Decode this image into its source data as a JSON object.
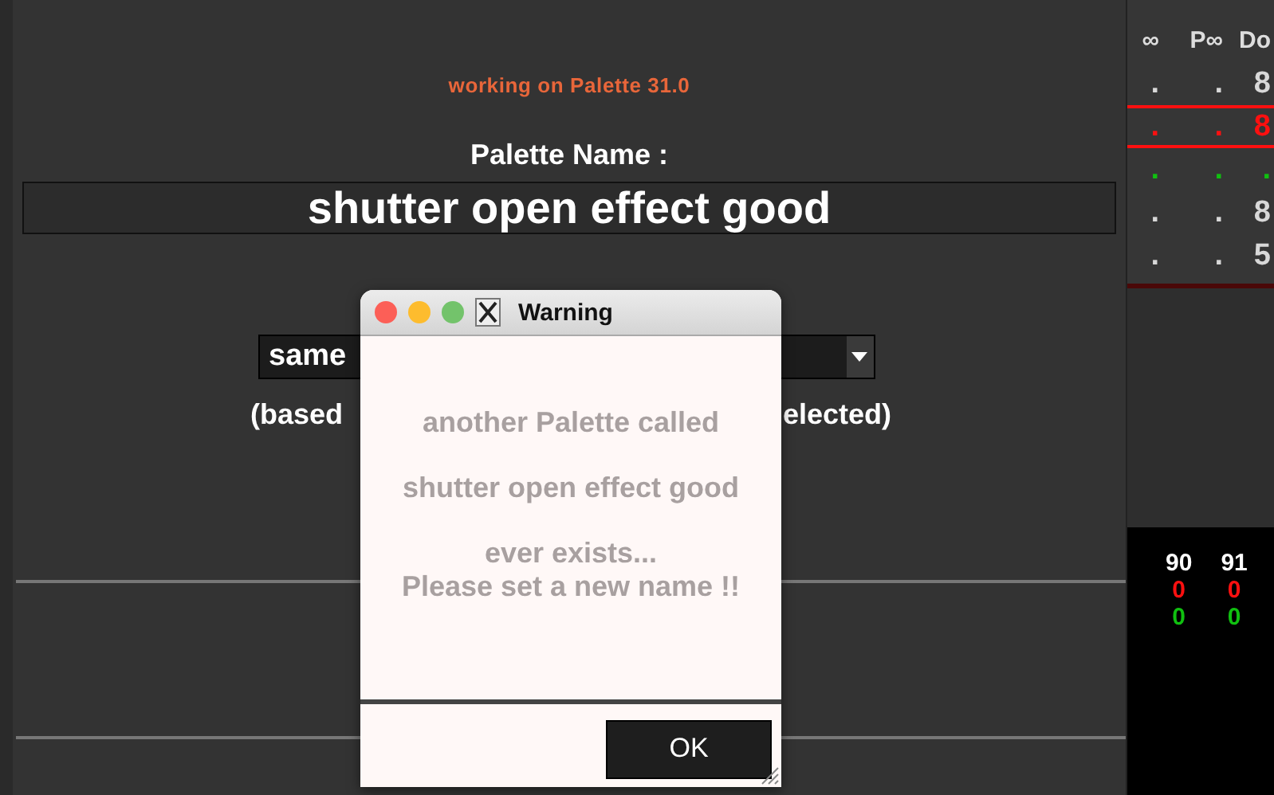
{
  "status": "working on Palette 31.0",
  "name_label": "Palette Name :",
  "name_field": {
    "value": "shutter open effect good"
  },
  "mode_dropdown": {
    "value": "same"
  },
  "note": [
    "(based",
    "elected)"
  ],
  "side_table": {
    "columns": [
      "∞",
      "P∞",
      "Do"
    ],
    "rows": [
      {
        "cells": [
          ".",
          ".",
          "8"
        ],
        "color": "#d8d8d8",
        "highlighted": false
      },
      {
        "cells": [
          ".",
          ".",
          "8"
        ],
        "color": "#ff1010",
        "highlighted": true
      },
      {
        "cells": [
          ".",
          ".",
          "."
        ],
        "color": "#10c010",
        "highlighted": false
      },
      {
        "cells": [
          ".",
          ".",
          "8"
        ],
        "color": "#d8d8d8",
        "highlighted": false
      },
      {
        "cells": [
          ".",
          ".",
          "5"
        ],
        "color": "#d8d8d8",
        "highlighted": false
      }
    ]
  },
  "channels": [
    {
      "label": "90",
      "values": [
        {
          "text": "0",
          "color": "#ff1010"
        },
        {
          "text": "0",
          "color": "#10c010"
        }
      ]
    },
    {
      "label": "91",
      "values": [
        {
          "text": "0",
          "color": "#ff1010"
        },
        {
          "text": "0",
          "color": "#10c010"
        }
      ]
    }
  ],
  "dialog": {
    "title": "Warning",
    "lines": [
      "another Palette called",
      "shutter open effect good",
      "ever exists...",
      "Please set a new name !!"
    ],
    "button": "OK"
  }
}
